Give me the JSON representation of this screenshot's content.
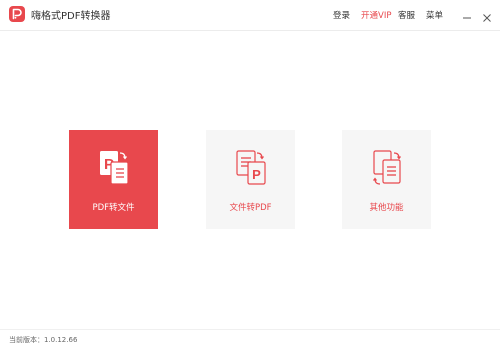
{
  "app": {
    "title": "嗨格式PDF转换器"
  },
  "header": {
    "login": "登录",
    "vip": "开通VIP",
    "service": "客服",
    "menu": "菜单"
  },
  "cards": [
    {
      "label": "PDF转文件",
      "icon": "pdf-to-file-icon"
    },
    {
      "label": "文件转PDF",
      "icon": "file-to-pdf-icon"
    },
    {
      "label": "其他功能",
      "icon": "other-functions-icon"
    }
  ],
  "footer": {
    "version": "当前版本：1.0.12.66"
  },
  "colors": {
    "accent": "#e8484d",
    "card_bg": "#f6f6f6"
  }
}
